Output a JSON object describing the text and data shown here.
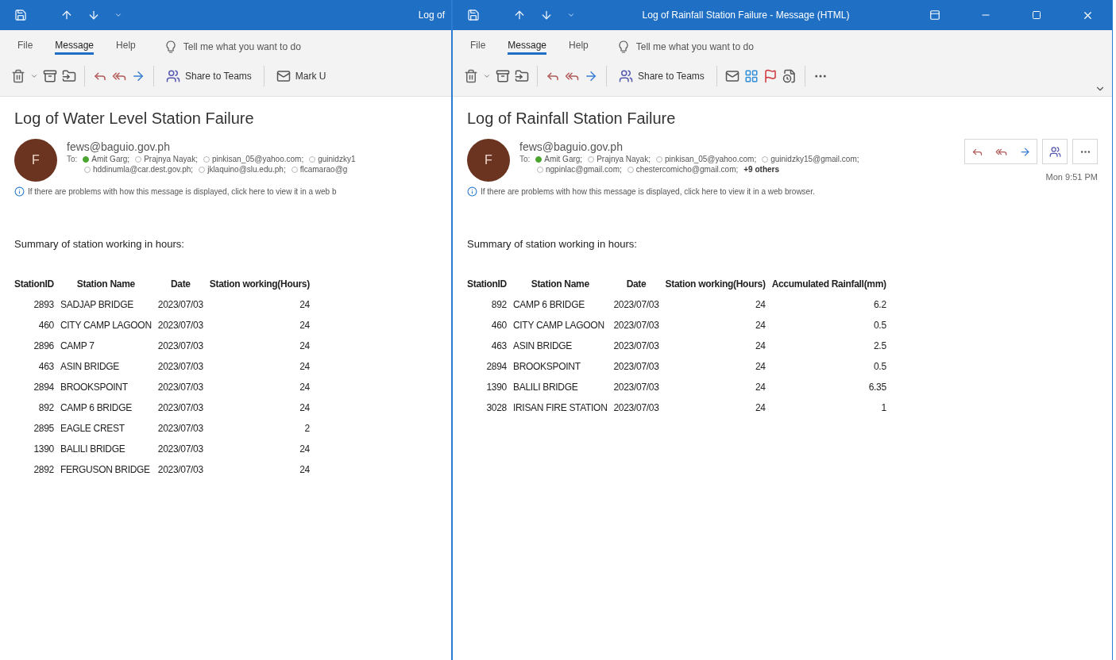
{
  "windows": [
    {
      "title": "Log of",
      "menu": [
        {
          "label": "File",
          "selected": false
        },
        {
          "label": "Message",
          "selected": true
        },
        {
          "label": "Help",
          "selected": false
        }
      ],
      "tell_me": "Tell me what you want to do",
      "toolbar": [
        {
          "kind": "delete"
        },
        {
          "kind": "dropdown"
        },
        {
          "kind": "archive"
        },
        {
          "kind": "move"
        },
        {
          "kind": "separator"
        },
        {
          "kind": "reply"
        },
        {
          "kind": "reply-all"
        },
        {
          "kind": "forward"
        },
        {
          "kind": "separator"
        },
        {
          "kind": "teams",
          "label": "Share to Teams"
        },
        {
          "kind": "separator"
        },
        {
          "kind": "mail",
          "label": "Mark U"
        }
      ],
      "subject": "Log of Water Level Station Failure",
      "sender": {
        "initial": "F",
        "address": "fews@baguio.gov.ph"
      },
      "to_label": "To:",
      "recipient_lines": [
        {
          "recipients": [
            {
              "name": "Amit Garg;",
              "online": true
            },
            {
              "name": "Prajnya Nayak;",
              "online": false
            },
            {
              "name": "pinkisan_05@yahoo.com;",
              "online": false
            },
            {
              "name": "guinidzky1",
              "online": false
            }
          ]
        },
        {
          "recipients": [
            {
              "name": "hddinumla@car.dest.gov.ph;",
              "online": false
            },
            {
              "name": "jklaquino@slu.edu.ph;",
              "online": false
            },
            {
              "name": "flcamarao@g",
              "online": false
            }
          ]
        }
      ],
      "info": "If there are problems with how this message is displayed, click here to view it in a web b",
      "summary": "Summary of station working in hours:",
      "columns": [
        "StationID",
        "Station Name",
        "Date",
        "Station working(Hours)"
      ],
      "rows": [
        [
          "2893",
          "SADJAP BRIDGE",
          "2023/07/03",
          "24"
        ],
        [
          "460",
          "CITY CAMP LAGOON",
          "2023/07/03",
          "24"
        ],
        [
          "2896",
          "CAMP 7",
          "2023/07/03",
          "24"
        ],
        [
          "463",
          "ASIN BRIDGE",
          "2023/07/03",
          "24"
        ],
        [
          "2894",
          "BROOKSPOINT",
          "2023/07/03",
          "24"
        ],
        [
          "892",
          "CAMP 6 BRIDGE",
          "2023/07/03",
          "24"
        ],
        [
          "2895",
          "EAGLE CREST",
          "2023/07/03",
          "2"
        ],
        [
          "1390",
          "BALILI BRIDGE",
          "2023/07/03",
          "24"
        ],
        [
          "2892",
          "FERGUSON BRIDGE",
          "2023/07/03",
          "24"
        ]
      ]
    },
    {
      "title": "Log of Rainfall Station Failure  -  Message (HTML)",
      "window_controls": true,
      "menu": [
        {
          "label": "File",
          "selected": false
        },
        {
          "label": "Message",
          "selected": true
        },
        {
          "label": "Help",
          "selected": false
        }
      ],
      "tell_me": "Tell me what you want to do",
      "toolbar": [
        {
          "kind": "delete"
        },
        {
          "kind": "dropdown"
        },
        {
          "kind": "archive"
        },
        {
          "kind": "move"
        },
        {
          "kind": "separator"
        },
        {
          "kind": "reply"
        },
        {
          "kind": "reply-all"
        },
        {
          "kind": "forward"
        },
        {
          "kind": "separator"
        },
        {
          "kind": "teams",
          "label": "Share to Teams"
        },
        {
          "kind": "separator"
        },
        {
          "kind": "mail"
        },
        {
          "kind": "categorize"
        },
        {
          "kind": "flag"
        },
        {
          "kind": "policy"
        },
        {
          "kind": "separator"
        },
        {
          "kind": "more"
        }
      ],
      "subject": "Log of Rainfall Station Failure",
      "sender": {
        "initial": "F",
        "address": "fews@baguio.gov.ph"
      },
      "to_label": "To:",
      "recipient_lines": [
        {
          "recipients": [
            {
              "name": "Amit Garg;",
              "online": true
            },
            {
              "name": "Prajnya Nayak;",
              "online": false
            },
            {
              "name": "pinkisan_05@yahoo.com;",
              "online": false
            },
            {
              "name": "guinidzky15@gmail.com;",
              "online": false
            }
          ]
        },
        {
          "recipients": [
            {
              "name": "ngpinlac@gmail.com;",
              "online": false
            },
            {
              "name": "chestercomicho@gmail.com;",
              "online": false
            }
          ],
          "more": "+9 others"
        }
      ],
      "actions": [
        {
          "kind": "reply"
        },
        {
          "kind": "reply-all"
        },
        {
          "kind": "forward"
        },
        {
          "kind": "teams"
        },
        {
          "kind": "more"
        }
      ],
      "time": "Mon 9:51 PM",
      "info": "If there are problems with how this message is displayed, click here to view it in a web browser.",
      "summary": "Summary of station working in hours:",
      "columns": [
        "StationID",
        "Station Name",
        "Date",
        "Station working(Hours)",
        "Accumulated Rainfall(mm)"
      ],
      "rows": [
        [
          "892",
          "CAMP 6 BRIDGE",
          "2023/07/03",
          "24",
          "6.2"
        ],
        [
          "460",
          "CITY CAMP LAGOON",
          "2023/07/03",
          "24",
          "0.5"
        ],
        [
          "463",
          "ASIN BRIDGE",
          "2023/07/03",
          "24",
          "2.5"
        ],
        [
          "2894",
          "BROOKSPOINT",
          "2023/07/03",
          "24",
          "0.5"
        ],
        [
          "1390",
          "BALILI BRIDGE",
          "2023/07/03",
          "24",
          "6.35"
        ],
        [
          "3028",
          "IRISAN FIRE STATION",
          "2023/07/03",
          "24",
          "1"
        ]
      ]
    }
  ]
}
